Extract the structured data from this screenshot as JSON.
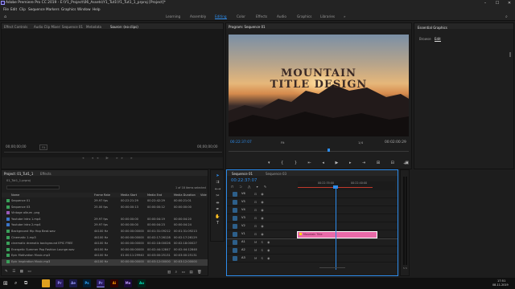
{
  "app": {
    "title": "Adobe Premiere Pro CC 2019 - E:\\Y1_Project\\06_Assets\\Y1_Tut1\\Y1_Tut1_1_prproj [Project]*"
  },
  "window_controls": {
    "minimize": "–",
    "maximize": "☐",
    "close": "✕"
  },
  "menu": [
    "File",
    "Edit",
    "Clip",
    "Sequence",
    "Markers",
    "Graphics",
    "Window",
    "Help"
  ],
  "workspaces": {
    "items": [
      "Learning",
      "Assembly",
      "Editing",
      "Color",
      "Effects",
      "Audio",
      "Graphics",
      "Libraries"
    ],
    "active": "Editing",
    "more": "»"
  },
  "source_panel": {
    "tabs": [
      "Effect Controls",
      "Audio Clip Mixer: Sequence 01",
      "Metadata",
      "Source: (no clips)"
    ],
    "left_tc": "00;00;00;00",
    "right_tc": "00;00;00;00",
    "fit": "Fit"
  },
  "program_panel": {
    "tab": "Program: Sequence 01",
    "title_line1": "MOUNTAIN",
    "title_line2": "TITLE DESIGN",
    "timecode": "00:22:37:07",
    "fit": "Fit",
    "scale": "1/4",
    "duration": "00:02:00:29"
  },
  "essential_graphics": {
    "tab": "Essential Graphics",
    "subtabs": [
      "Browse",
      "Edit"
    ],
    "active_subtab": "Edit"
  },
  "project_panel": {
    "tabs": [
      "Project: 01_Tut1_1",
      "Effects"
    ],
    "project_file": "01_Tut1_1.prproj",
    "selection_info": "1 of 18 items selected",
    "columns": [
      "Name",
      "Frame Rate",
      "Media Start",
      "Media End",
      "Media Duration",
      "Vide"
    ],
    "rows": [
      {
        "name": "Sequence 01",
        "color": "#3aa05a",
        "fps": "29.97 fps",
        "start": "00:22:21:29",
        "end": "00:22:42:29",
        "dur": "00:00:21:01"
      },
      {
        "name": "Sequence 03",
        "color": "#3aa05a",
        "fps": "25.00 fps",
        "start": "00:00:00:13",
        "end": "00:00:00:12",
        "dur": "00:00:00:00"
      },
      {
        "name": "Vintage album .png",
        "color": "#9a5ab8",
        "fps": "",
        "start": "",
        "end": "",
        "dur": ""
      },
      {
        "name": "Youtube Intro 1.mp4",
        "color": "#3a76c8",
        "fps": "29.97 fps",
        "start": "00:00:00:00",
        "end": "00:00:04:19",
        "dur": "00:00:04:20"
      },
      {
        "name": "Youtube Intro 2.mp4",
        "color": "#3a76c8",
        "fps": "29.97 fps",
        "start": "00:00:00:00",
        "end": "00:00:04:23",
        "dur": "00:00:04:24"
      },
      {
        "name": "Background Hip Hop Beat.wav",
        "color": "#3aa05a",
        "fps": "44100 Hz",
        "start": "00:00:00:00000",
        "end": "00:01:31:09212",
        "dur": "00:01:31:09213"
      },
      {
        "name": "Cinematic 1.mp3",
        "color": "#3aa05a",
        "fps": "44100 Hz",
        "start": "00:00:00:00000",
        "end": "00:02:17:26128",
        "dur": "00:02:17:26129"
      },
      {
        "name": "cinematic dramatic background EPIC FREE",
        "color": "#3aa05a",
        "fps": "44100 Hz",
        "start": "00:00:00:00000",
        "end": "00:02:18:00026",
        "dur": "00:02:18:00027"
      },
      {
        "name": "Energetic Summer Pop Fashion Lounge.wav",
        "color": "#3aa05a",
        "fps": "44100 Hz",
        "start": "00:00:00:00000",
        "end": "00:02:44:12847",
        "dur": "00:02:44:12848"
      },
      {
        "name": "Epic Motivation Music.mp3",
        "color": "#3aa05a",
        "fps": "44100 Hz",
        "start": "01:00:11:29940",
        "end": "00:03:00:25131",
        "dur": "00:03:00:25131"
      },
      {
        "name": "Epic Inspiration Music.mp3",
        "color": "#3aa05a",
        "fps": "44100 Hz",
        "start": "00:00:00:00000",
        "end": "00:03:12:00000",
        "dur": "00:03:12:00000"
      }
    ]
  },
  "timeline": {
    "tabs": [
      "Sequence 01",
      "Sequence 03"
    ],
    "timecode": "00:22:37:07",
    "ruler": [
      "00:22:35:00",
      "00:22:40:00"
    ],
    "clip_label": "Mountain Title",
    "tracks": [
      "V6",
      "V5",
      "V4",
      "V3",
      "V2",
      "V1",
      "A1",
      "A2",
      "A3"
    ]
  },
  "taskbar": {
    "apps": [
      "Pr",
      "Ae",
      "Ps",
      "Pr",
      "Ai",
      "Me",
      "Au"
    ],
    "time": "17:51",
    "date": "08-11-2019"
  }
}
